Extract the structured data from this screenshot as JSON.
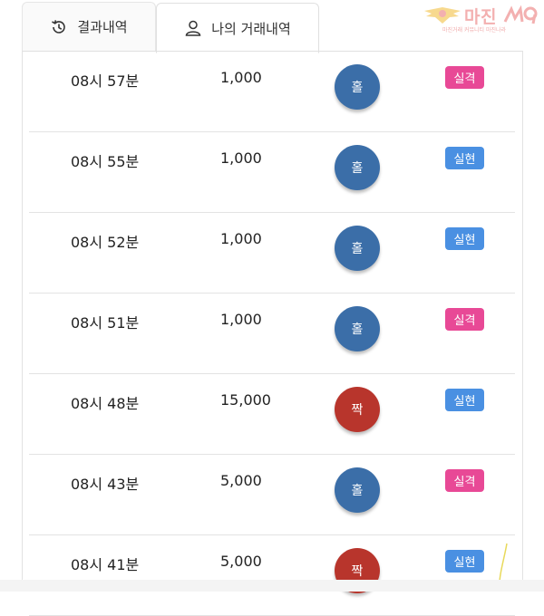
{
  "tabs": {
    "results_label": "결과내역",
    "my_trades_label": "나의 거래내역",
    "results_icon": "history-icon",
    "my_trades_icon": "user-icon"
  },
  "logo": {
    "text": "마진",
    "subtitle": "마진거래 커뮤니티 마진나라"
  },
  "rows": [
    {
      "time": "08시 57분",
      "amount": "1,000",
      "pick": "홀",
      "pick_type": "odd",
      "result": "실격",
      "result_type": "fail"
    },
    {
      "time": "08시 55분",
      "amount": "1,000",
      "pick": "홀",
      "pick_type": "odd",
      "result": "실현",
      "result_type": "ok"
    },
    {
      "time": "08시 52분",
      "amount": "1,000",
      "pick": "홀",
      "pick_type": "odd",
      "result": "실현",
      "result_type": "ok"
    },
    {
      "time": "08시 51분",
      "amount": "1,000",
      "pick": "홀",
      "pick_type": "odd",
      "result": "실격",
      "result_type": "fail"
    },
    {
      "time": "08시 48분",
      "amount": "15,000",
      "pick": "짝",
      "pick_type": "even",
      "result": "실현",
      "result_type": "ok"
    },
    {
      "time": "08시 43분",
      "amount": "5,000",
      "pick": "홀",
      "pick_type": "odd",
      "result": "실격",
      "result_type": "fail"
    },
    {
      "time": "08시 41분",
      "amount": "5,000",
      "pick": "짝",
      "pick_type": "even",
      "result": "실현",
      "result_type": "ok"
    }
  ],
  "colors": {
    "odd_ball": "#3b6ea8",
    "even_ball": "#b8352c",
    "badge_fail": "#e84996",
    "badge_ok": "#4a90e2"
  }
}
